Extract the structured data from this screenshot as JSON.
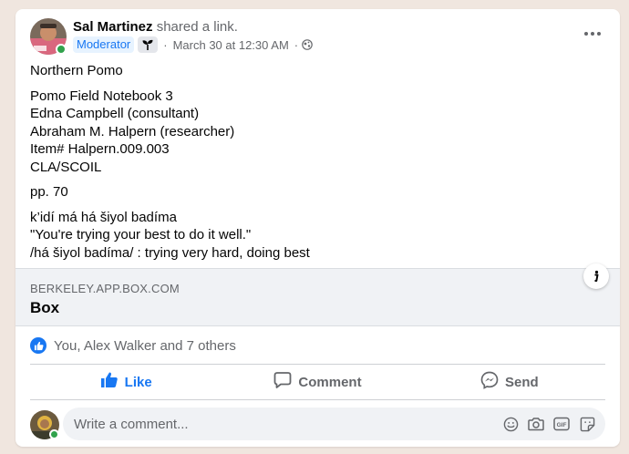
{
  "post": {
    "author": "Sal Martinez",
    "action": "shared a link.",
    "badge": "Moderator",
    "timestamp": "March 30 at 12:30 AM",
    "meta_sep": "·",
    "audience_icon": "globe-icon",
    "badge_icon": "sprout-icon"
  },
  "body": {
    "title": "Northern Pomo",
    "notebook": [
      "Pomo Field Notebook 3",
      "Edna Campbell (consultant)",
      "Abraham M. Halpern (researcher)",
      "Item# Halpern.009.003",
      "CLA/SCOIL"
    ],
    "pages": "pp. 70",
    "entry": [
      "k’idí má há šiyol badíma",
      "\"You're trying your best to do it well.\"",
      "/há šiyol badíma/ : trying very hard, doing best"
    ]
  },
  "link": {
    "domain": "BERKELEY.APP.BOX.COM",
    "title": "Box"
  },
  "reactions": {
    "summary": "You, Alex Walker and 7 others"
  },
  "actions": {
    "like": "Like",
    "comment": "Comment",
    "send": "Send"
  },
  "comment": {
    "placeholder": "Write a comment...",
    "icons": [
      "emoji-icon",
      "camera-icon",
      "gif-icon",
      "sticker-icon"
    ]
  },
  "colors": {
    "accent": "#1877f2",
    "online": "#31a24c",
    "secondary_text": "#65676b",
    "background": "#f0e6df"
  }
}
